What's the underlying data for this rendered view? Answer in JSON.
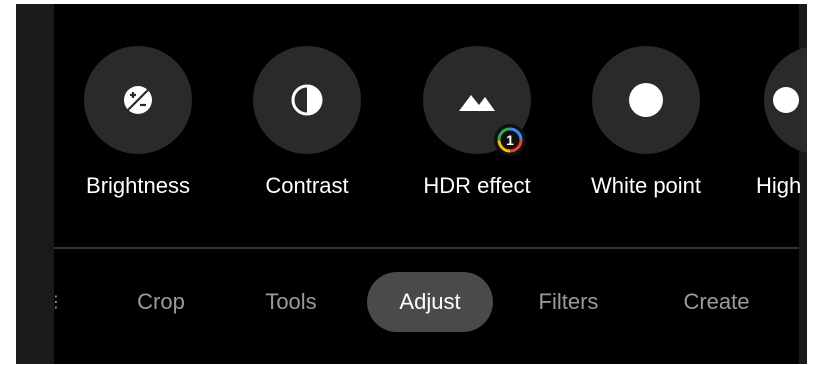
{
  "tools": [
    {
      "label": "Brightness",
      "icon": "brightness-icon"
    },
    {
      "label": "Contrast",
      "icon": "contrast-icon"
    },
    {
      "label": "HDR effect",
      "icon": "mountain-icon"
    },
    {
      "label": "White point",
      "icon": "white-point-icon"
    },
    {
      "label": "High",
      "icon": "highlights-icon"
    }
  ],
  "hdr_badge": {
    "value": "1"
  },
  "nav": {
    "tabs": [
      {
        "label": "Crop"
      },
      {
        "label": "Tools"
      },
      {
        "label": "Adjust"
      },
      {
        "label": "Filters"
      },
      {
        "label": "Create"
      }
    ],
    "active": "Adjust"
  },
  "colors": {
    "background": "#000000",
    "tool_circle": "#2a2a2a",
    "active_tab": "#4a4a4a",
    "inactive_text": "#9a9a9a"
  }
}
